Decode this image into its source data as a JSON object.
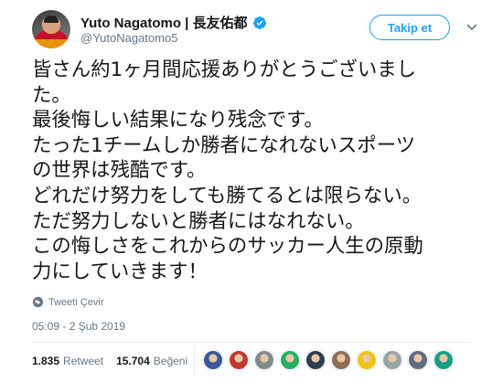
{
  "author": {
    "display_name": "Yuto Nagatomo | 長友佑都",
    "handle": "@YutoNagatomo5",
    "verified": true,
    "avatar_icon": "profile-photo"
  },
  "follow_button": {
    "label": "Takip et"
  },
  "menu_icon": "chevron-down-icon",
  "tweet": {
    "lines": [
      "皆さん約1ヶ月間応援ありがとうございまし",
      "た。",
      "最後悔しい結果になり残念です。",
      "たった1チームしか勝者になれないスポーツ",
      "の世界は残酷です。",
      "どれだけ努力をしても勝てるとは限らない。",
      "ただ努力しないと勝者にはなれない。",
      "この悔しさをこれからのサッカー人生の原動",
      "力にしていきます！"
    ]
  },
  "translate": {
    "label": "Tweeti Çevir",
    "icon": "globe-icon"
  },
  "timestamp": "05:09 - 2 Şub 2019",
  "stats": {
    "retweet_count": "1.835",
    "retweet_label": "Retweet",
    "like_count": "15.704",
    "like_label": "Beğeni"
  },
  "liker_avatar_colors": [
    "#3b5998",
    "#c0392b",
    "#7f8c8d",
    "#27ae60",
    "#2c3e50",
    "#8e6e53",
    "#f1c40f",
    "#95a5a6",
    "#5d6d7e",
    "#16a085"
  ],
  "colors": {
    "accent": "#1da1f2",
    "muted": "#657786",
    "text": "#14171a"
  }
}
